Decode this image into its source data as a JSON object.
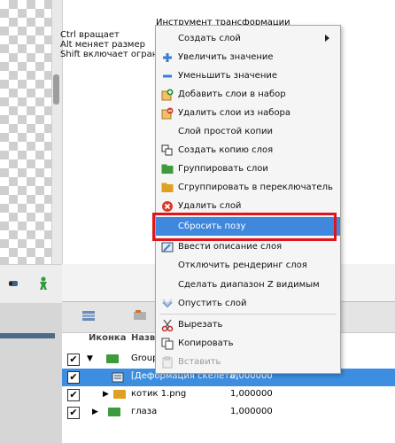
{
  "tooltip": {
    "line1": "Ctrl вращает",
    "line2": "Alt меняет размер",
    "line3": "Shift включает огранич"
  },
  "menu": {
    "title": "Инструмент трансформации",
    "items": [
      {
        "label": "Создать слой",
        "icon": "none",
        "submenu": true
      },
      {
        "label": "Увеличить значение",
        "icon": "plus-icon"
      },
      {
        "label": "Уменьшить значение",
        "icon": "minus-icon"
      },
      {
        "label": "Добавить слои в набор",
        "icon": "add-to-set-icon"
      },
      {
        "label": "Удалить слои из набора",
        "icon": "remove-from-set-icon"
      },
      {
        "label": "Слой простой копии",
        "icon": "none"
      },
      {
        "label": "Создать копию слоя",
        "icon": "duplicate-icon"
      },
      {
        "label": "Группировать слои",
        "icon": "folder-icon"
      },
      {
        "label": "Сгруппировать в переключатель",
        "icon": "switch-folder-icon"
      },
      {
        "label": "Удалить слой",
        "icon": "delete-icon"
      },
      {
        "label": "Сбросить позу",
        "icon": "none",
        "highlighted": true
      },
      {
        "label": "Ввести описание слоя",
        "icon": "describe-icon"
      },
      {
        "label": "Отключить рендеринг слоя",
        "icon": "none"
      },
      {
        "label": "Сделать диапазон Z видимым",
        "icon": "none"
      },
      {
        "label": "Опустить слой",
        "icon": "lower-icon"
      },
      {
        "label": "Вырезать",
        "icon": "scissors-icon"
      },
      {
        "label": "Копировать",
        "icon": "copy-icon"
      },
      {
        "label": "Вставить",
        "icon": "paste-icon",
        "disabled": true
      }
    ]
  },
  "layers": {
    "col_icon": "Иконка",
    "col_name": "Назв",
    "rows": [
      {
        "name": "Group",
        "value": ""
      },
      {
        "name": "[Деформация скелета]",
        "value": "0,000000"
      },
      {
        "name": "котик 1.png",
        "value": "1,000000"
      },
      {
        "name": "глаза",
        "value": "1,000000"
      }
    ]
  },
  "colors": {
    "highlight": "#3f88de",
    "annotation": "#e0151b"
  }
}
